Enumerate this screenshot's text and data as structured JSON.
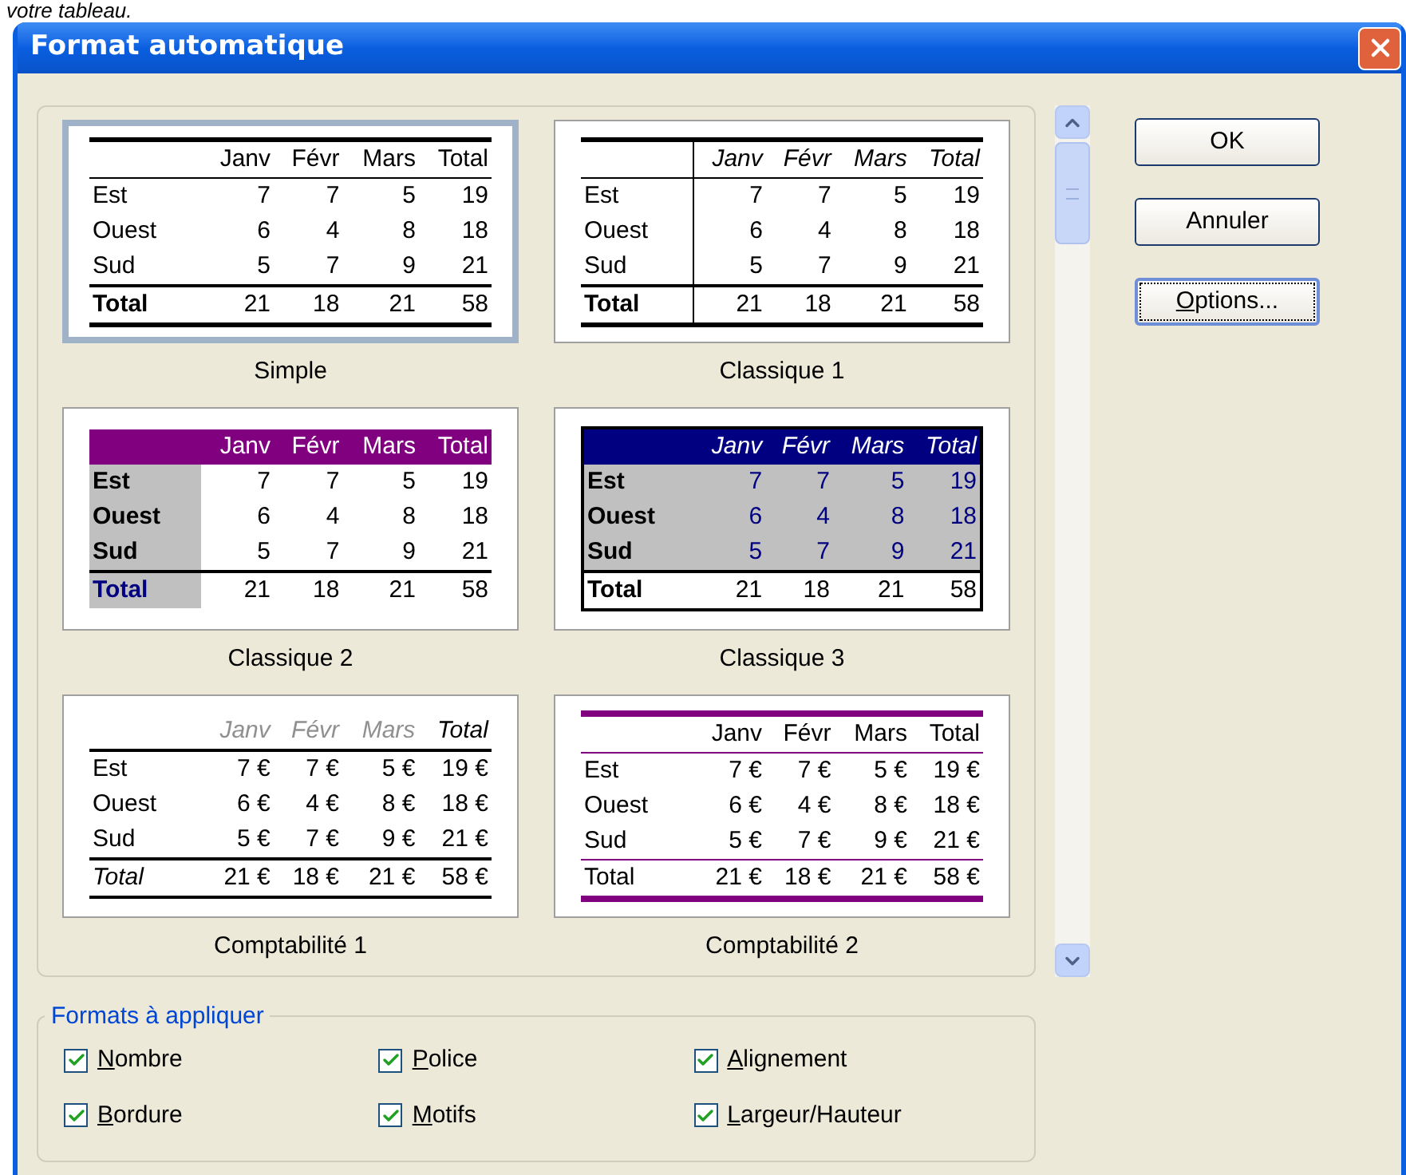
{
  "page_text": "votre tableau.",
  "dialog": {
    "title": "Format automatique",
    "formats": [
      {
        "kind": "simple",
        "name": "Simple",
        "selected": true,
        "header": [
          "Janv",
          "Févr",
          "Mars",
          "Total"
        ],
        "rows": [
          {
            "label": "Est",
            "values": [
              "7",
              "7",
              "5",
              "19"
            ]
          },
          {
            "label": "Ouest",
            "values": [
              "6",
              "4",
              "8",
              "18"
            ]
          },
          {
            "label": "Sud",
            "values": [
              "5",
              "7",
              "9",
              "21"
            ]
          },
          {
            "label": "Total",
            "values": [
              "21",
              "18",
              "21",
              "58"
            ]
          }
        ]
      },
      {
        "kind": "classique1",
        "name": "Classique 1",
        "selected": false,
        "header": [
          "Janv",
          "Févr",
          "Mars",
          "Total"
        ],
        "rows": [
          {
            "label": "Est",
            "values": [
              "7",
              "7",
              "5",
              "19"
            ]
          },
          {
            "label": "Ouest",
            "values": [
              "6",
              "4",
              "8",
              "18"
            ]
          },
          {
            "label": "Sud",
            "values": [
              "5",
              "7",
              "9",
              "21"
            ]
          },
          {
            "label": "Total",
            "values": [
              "21",
              "18",
              "21",
              "58"
            ]
          }
        ]
      },
      {
        "kind": "classique2",
        "name": "Classique 2",
        "selected": false,
        "header": [
          "Janv",
          "Févr",
          "Mars",
          "Total"
        ],
        "rows": [
          {
            "label": "Est",
            "values": [
              "7",
              "7",
              "5",
              "19"
            ]
          },
          {
            "label": "Ouest",
            "values": [
              "6",
              "4",
              "8",
              "18"
            ]
          },
          {
            "label": "Sud",
            "values": [
              "5",
              "7",
              "9",
              "21"
            ]
          },
          {
            "label": "Total",
            "values": [
              "21",
              "18",
              "21",
              "58"
            ]
          }
        ]
      },
      {
        "kind": "classique3",
        "name": "Classique 3",
        "selected": false,
        "header": [
          "Janv",
          "Févr",
          "Mars",
          "Total"
        ],
        "rows": [
          {
            "label": "Est",
            "values": [
              "7",
              "7",
              "5",
              "19"
            ]
          },
          {
            "label": "Ouest",
            "values": [
              "6",
              "4",
              "8",
              "18"
            ]
          },
          {
            "label": "Sud",
            "values": [
              "5",
              "7",
              "9",
              "21"
            ]
          },
          {
            "label": "Total",
            "values": [
              "21",
              "18",
              "21",
              "58"
            ]
          }
        ]
      },
      {
        "kind": "comptabilite1",
        "name": "Comptabilité 1",
        "selected": false,
        "header": [
          "Janv",
          "Févr",
          "Mars",
          "Total"
        ],
        "rows": [
          {
            "label": "Est",
            "values": [
              "7 €",
              "7 €",
              "5 €",
              "19 €"
            ]
          },
          {
            "label": "Ouest",
            "values": [
              "6 €",
              "4 €",
              "8 €",
              "18 €"
            ]
          },
          {
            "label": "Sud",
            "values": [
              "5 €",
              "7 €",
              "9 €",
              "21 €"
            ]
          },
          {
            "label": "Total",
            "values": [
              "21 €",
              "18 €",
              "21 €",
              "58 €"
            ]
          }
        ]
      },
      {
        "kind": "comptabilite2",
        "name": "Comptabilité 2",
        "selected": false,
        "header": [
          "Janv",
          "Févr",
          "Mars",
          "Total"
        ],
        "rows": [
          {
            "label": "Est",
            "values": [
              "7 €",
              "7 €",
              "5 €",
              "19 €"
            ]
          },
          {
            "label": "Ouest",
            "values": [
              "6 €",
              "4 €",
              "8 €",
              "18 €"
            ]
          },
          {
            "label": "Sud",
            "values": [
              "5 €",
              "7 €",
              "9 €",
              "21 €"
            ]
          },
          {
            "label": "Total",
            "values": [
              "21 €",
              "18 €",
              "21 €",
              "58 €"
            ]
          }
        ]
      }
    ],
    "buttons": [
      {
        "label": "OK",
        "focused": false
      },
      {
        "label": "Annuler",
        "focused": false
      },
      {
        "label": "Options...",
        "focused": true
      }
    ],
    "apply_group": {
      "title": "Formats à appliquer",
      "options": [
        {
          "label": "Nombre",
          "checked": true
        },
        {
          "label": "Police",
          "checked": true
        },
        {
          "label": "Alignement",
          "checked": true
        },
        {
          "label": "Bordure",
          "checked": true
        },
        {
          "label": "Motifs",
          "checked": true
        },
        {
          "label": "Largeur/Hauteur",
          "checked": true
        }
      ]
    }
  }
}
